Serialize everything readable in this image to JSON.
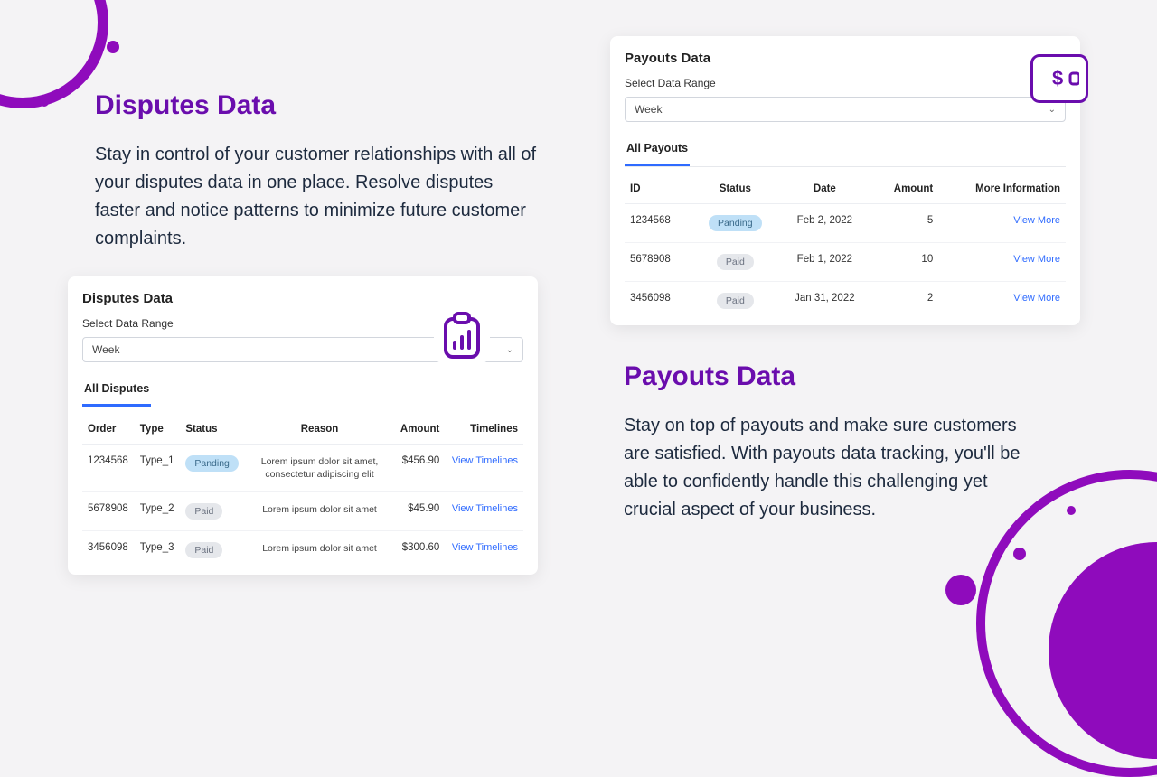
{
  "left": {
    "heading": "Disputes Data",
    "description": "Stay in control of your customer relationships with all of your disputes data in one place. Resolve disputes faster and notice patterns to minimize future customer complaints.",
    "card": {
      "title": "Disputes Data",
      "range_label": "Select Data Range",
      "range_value": "Week",
      "tab": "All Disputes",
      "columns": {
        "order": "Order",
        "type": "Type",
        "status": "Status",
        "reason": "Reason",
        "amount": "Amount",
        "timelines": "Timelines"
      },
      "link_label": "View Timelines",
      "rows": [
        {
          "order": "1234568",
          "type": "Type_1",
          "status": "Panding",
          "status_kind": "pending",
          "reason": "Lorem ipsum dolor sit amet, consectetur adipiscing elit",
          "amount": "$456.90"
        },
        {
          "order": "5678908",
          "type": "Type_2",
          "status": "Paid",
          "status_kind": "paid",
          "reason": "Lorem ipsum dolor sit amet",
          "amount": "$45.90"
        },
        {
          "order": "3456098",
          "type": "Type_3",
          "status": "Paid",
          "status_kind": "paid",
          "reason": "Lorem ipsum dolor sit amet",
          "amount": "$300.60"
        }
      ]
    }
  },
  "right": {
    "heading": "Payouts Data",
    "description": "Stay on top of payouts and make sure customers are satisfied. With payouts data tracking, you'll be able to confidently handle this challenging yet crucial aspect of your business.",
    "card": {
      "title": "Payouts Data",
      "range_label": "Select Data Range",
      "range_value": "Week",
      "tab": "All Payouts",
      "columns": {
        "id": "ID",
        "status": "Status",
        "date": "Date",
        "amount": "Amount",
        "more": "More Information"
      },
      "link_label": "View More",
      "rows": [
        {
          "id": "1234568",
          "status": "Panding",
          "status_kind": "pending",
          "date": "Feb 2, 2022",
          "amount": "5"
        },
        {
          "id": "5678908",
          "status": "Paid",
          "status_kind": "paid",
          "date": "Feb 1, 2022",
          "amount": "10"
        },
        {
          "id": "3456098",
          "status": "Paid",
          "status_kind": "paid",
          "date": "Jan 31, 2022",
          "amount": "2"
        }
      ]
    }
  }
}
